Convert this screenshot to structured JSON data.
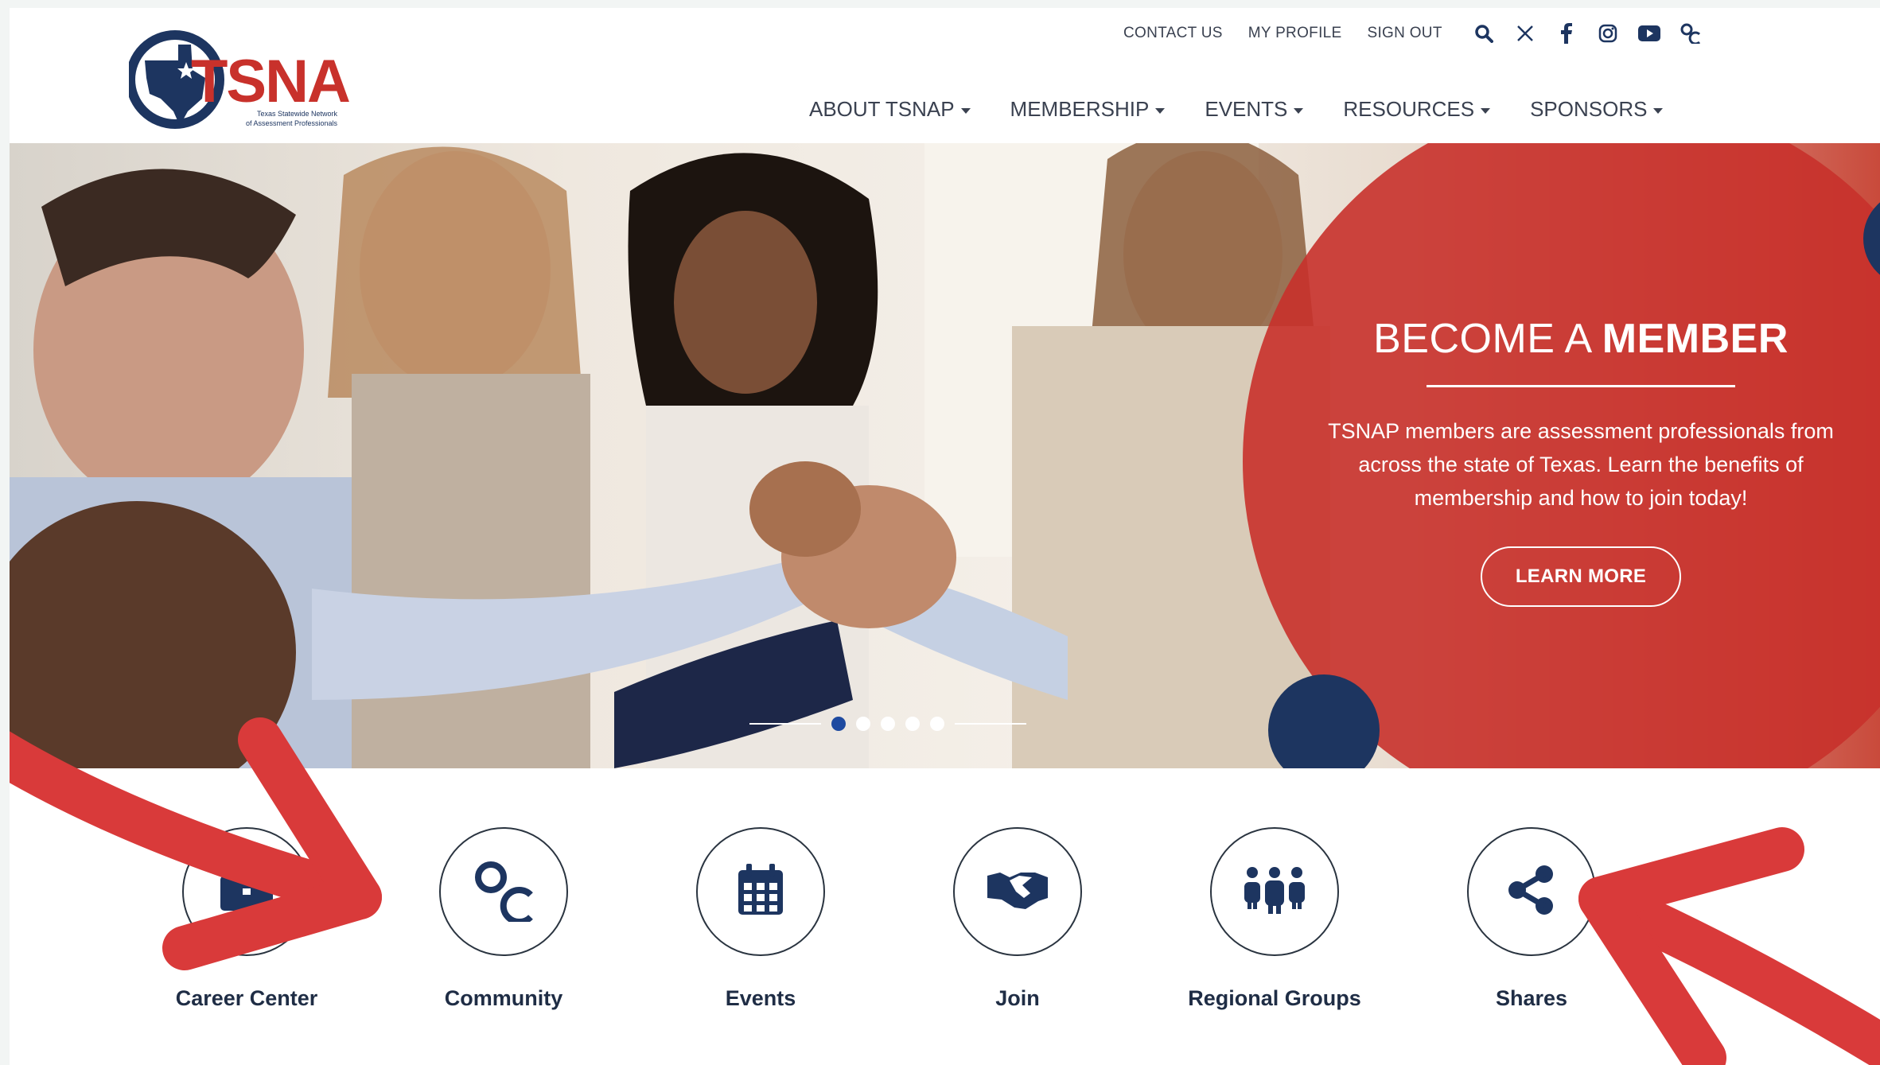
{
  "brand": {
    "logo_text": "TSNAP",
    "logo_subtitle_line1": "Texas Statewide Network",
    "logo_subtitle_line2": "of Assessment Professionals",
    "navy": "#1d3560",
    "red": "#c8312b"
  },
  "utility_links": [
    "CONTACT US",
    "MY PROFILE",
    "SIGN OUT"
  ],
  "social_icons": [
    "search-icon",
    "x-icon",
    "facebook-icon",
    "instagram-icon",
    "youtube-icon",
    "community-icon"
  ],
  "nav": {
    "items": [
      "ABOUT TSNAP",
      "MEMBERSHIP",
      "EVENTS",
      "RESOURCES",
      "SPONSORS"
    ]
  },
  "hero": {
    "title_light": "BECOME A ",
    "title_bold": "MEMBER",
    "text": "TSNAP members are assessment professionals from across the state of Texas. Learn the benefits of membership and how to join today!",
    "button": "LEARN MORE",
    "slide_count": 5,
    "active_slide": 1
  },
  "quick_links": [
    {
      "label": "Career Center",
      "icon": "briefcase-icon"
    },
    {
      "label": "Community",
      "icon": "community-icon"
    },
    {
      "label": "Events",
      "icon": "calendar-icon"
    },
    {
      "label": "Join",
      "icon": "handshake-icon"
    },
    {
      "label": "Regional Groups",
      "icon": "group-icon"
    },
    {
      "label": "Shares",
      "icon": "share-icon"
    }
  ],
  "annotation_color": "#d93a3a"
}
